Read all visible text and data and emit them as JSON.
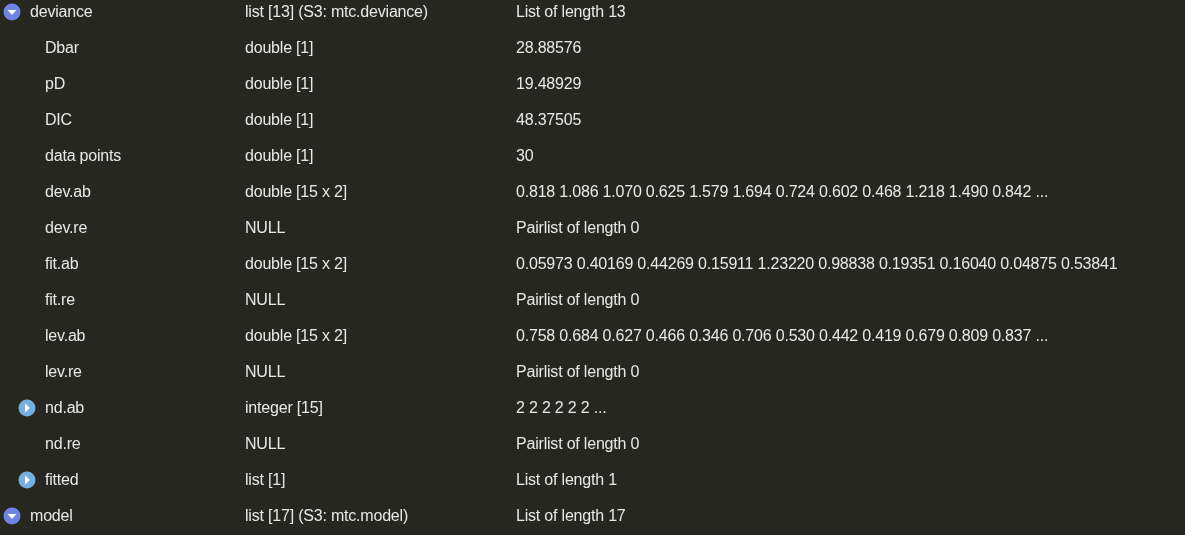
{
  "rows": [
    {
      "name": "deviance",
      "type": "list [13] (S3: mtc.deviance)",
      "value": "List of length 13",
      "kind": "expandable",
      "expanded": true,
      "children": [
        {
          "name": "Dbar",
          "type": "double [1]",
          "value": "28.88576",
          "kind": "leaf"
        },
        {
          "name": "pD",
          "type": "double [1]",
          "value": "19.48929",
          "kind": "leaf"
        },
        {
          "name": "DIC",
          "type": "double [1]",
          "value": "48.37505",
          "kind": "leaf"
        },
        {
          "name": "data points",
          "type": "double [1]",
          "value": "30",
          "kind": "leaf"
        },
        {
          "name": "dev.ab",
          "type": "double [15 x 2]",
          "value": "0.818 1.086 1.070 0.625 1.579 1.694 0.724 0.602 0.468 1.218 1.490 0.842 ...",
          "kind": "leaf"
        },
        {
          "name": "dev.re",
          "type": "NULL",
          "value": "Pairlist of length 0",
          "kind": "leaf"
        },
        {
          "name": "fit.ab",
          "type": "double [15 x 2]",
          "value": "0.05973 0.40169 0.44269 0.15911 1.23220 0.98838 0.19351 0.16040 0.04875 0.53841",
          "kind": "leaf"
        },
        {
          "name": "fit.re",
          "type": "NULL",
          "value": "Pairlist of length 0",
          "kind": "leaf"
        },
        {
          "name": "lev.ab",
          "type": "double [15 x 2]",
          "value": "0.758 0.684 0.627 0.466 0.346 0.706 0.530 0.442 0.419 0.679 0.809 0.837 ...",
          "kind": "leaf"
        },
        {
          "name": "lev.re",
          "type": "NULL",
          "value": "Pairlist of length 0",
          "kind": "leaf"
        },
        {
          "name": "nd.ab",
          "type": "integer [15]",
          "value": "2 2 2 2 2 2 ...",
          "kind": "expandable",
          "expanded": false
        },
        {
          "name": "nd.re",
          "type": "NULL",
          "value": "Pairlist of length 0",
          "kind": "leaf"
        },
        {
          "name": "fitted",
          "type": "list [1]",
          "value": "List of length 1",
          "kind": "expandable",
          "expanded": false
        }
      ]
    },
    {
      "name": "model",
      "type": "list [17] (S3: mtc.model)",
      "value": "List of length 17",
      "kind": "expandable",
      "expanded": true
    }
  ]
}
